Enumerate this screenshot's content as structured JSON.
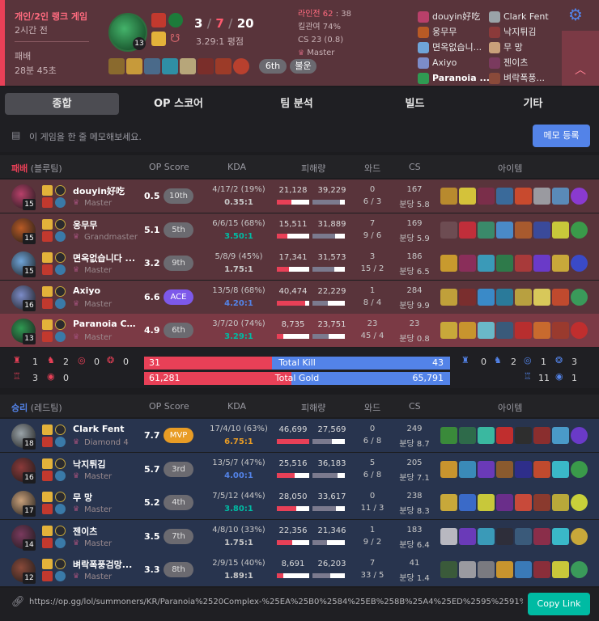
{
  "header": {
    "game_type": "개인/2인 랭크 게임",
    "time_ago": "2시간 전",
    "result": "패배",
    "duration": "28분 45초",
    "champion_level": "13",
    "kills": "3",
    "deaths": "7",
    "assists": "20",
    "kda_ratio": "3.29:1 평점",
    "laning_label": "라인전",
    "laning_a": "62",
    "laning_b": "38",
    "kp": "킬관여 74%",
    "cs": "CS 23 (0.8)",
    "tier": "Master",
    "badge_rank": "6th",
    "badge_tag": "불운",
    "players_left": [
      "douyin好吃",
      "웅무무",
      "면옥없습니...",
      "Axiyo",
      "Paranoia ..."
    ],
    "players_right": [
      "Clark Fent",
      "낙지튀김",
      "무 망",
      "젠이츠",
      "벼락폭풍..."
    ],
    "colors": {
      "lose_bg": "#59343b",
      "accent_red": "#e84057",
      "accent_blue": "#5383e8"
    }
  },
  "tabs": [
    "종합",
    "OP 스코어",
    "팀 분석",
    "빌드",
    "기타"
  ],
  "memo": {
    "placeholder": "이 게임을 한 줄 메모해보세요.",
    "button": "메모 등록"
  },
  "columns": {
    "op": "OP Score",
    "kda": "KDA",
    "dmg": "피해량",
    "ward": "와드",
    "cs": "CS",
    "items": "아이템"
  },
  "team_lose": {
    "label": "패배",
    "side": "(블루팀)",
    "players": [
      {
        "name": "douyin好吃",
        "tier": "Master",
        "level": "15",
        "score": "0.5",
        "rank": "10th",
        "kda_text": "4/17/2 (19%)",
        "kda_ratio": "0.35:1",
        "dealt": "21,128",
        "taken": "39,229",
        "dealt_pct": 0.45,
        "taken_pct": 0.85,
        "wards": "0",
        "wards2": "6 / 3",
        "cs": "167",
        "cs_min": "분당 5.8",
        "ratio_color": "gray",
        "champ_color": "#b8406a"
      },
      {
        "name": "웅무무",
        "tier": "Grandmaster",
        "level": "15",
        "score": "5.1",
        "rank": "5th",
        "kda_text": "6/6/15 (68%)",
        "kda_ratio": "3.50:1",
        "dealt": "15,511",
        "taken": "31,889",
        "dealt_pct": 0.33,
        "taken_pct": 0.69,
        "wards": "7",
        "wards2": "9 / 6",
        "cs": "169",
        "cs_min": "분당 5.9",
        "ratio_color": "teal",
        "champ_color": "#b85a25"
      },
      {
        "name": "면옥없습니다 ...",
        "tier": "Master",
        "level": "15",
        "score": "3.2",
        "rank": "9th",
        "kda_text": "5/8/9 (45%)",
        "kda_ratio": "1.75:1",
        "dealt": "17,341",
        "taken": "31,573",
        "dealt_pct": 0.37,
        "taken_pct": 0.68,
        "wards": "3",
        "wards2": "15 / 2",
        "cs": "186",
        "cs_min": "분당 6.5",
        "ratio_color": "gray",
        "champ_color": "#6fa4d8"
      },
      {
        "name": "Axiyo",
        "tier": "Master",
        "level": "16",
        "score": "6.6",
        "rank": "ACE",
        "kda_text": "13/5/8 (68%)",
        "kda_ratio": "4.20:1",
        "dealt": "40,474",
        "taken": "22,229",
        "dealt_pct": 0.87,
        "taken_pct": 0.48,
        "wards": "1",
        "wards2": "8 / 4",
        "cs": "284",
        "cs_min": "분당 9.9",
        "ratio_color": "blue",
        "champ_color": "#7c8cc8"
      },
      {
        "name": "Paranoia Co...",
        "tier": "Master",
        "level": "13",
        "score": "4.9",
        "rank": "6th",
        "kda_text": "3/7/20 (74%)",
        "kda_ratio": "3.29:1",
        "dealt": "8,735",
        "taken": "23,751",
        "dealt_pct": 0.19,
        "taken_pct": 0.51,
        "wards": "23",
        "wards2": "45 / 4",
        "cs": "23",
        "cs_min": "분당 0.8",
        "ratio_color": "teal",
        "champ_color": "#2f9a52"
      }
    ]
  },
  "summary": {
    "lose_objectives": [
      "1",
      "2",
      "0",
      "0",
      "3",
      "0"
    ],
    "win_objectives": [
      "0",
      "2",
      "1",
      "3",
      "11",
      "1"
    ],
    "total_kill_label": "Total Kill",
    "total_gold_label": "Total Gold",
    "kill_lose": "31",
    "kill_win": "43",
    "gold_lose": "61,281",
    "gold_win": "65,791",
    "kill_lose_frac": 0.419,
    "gold_lose_frac": 0.482
  },
  "team_win": {
    "label": "승리",
    "side": "(레드팀)",
    "players": [
      {
        "name": "Clark Fent",
        "tier": "Diamond 4",
        "level": "18",
        "score": "7.7",
        "rank": "MVP",
        "kda_text": "17/4/10 (63%)",
        "kda_ratio": "6.75:1",
        "dealt": "46,699",
        "taken": "27,569",
        "dealt_pct": 1.0,
        "taken_pct": 0.59,
        "wards": "0",
        "wards2": "6 / 8",
        "cs": "249",
        "cs_min": "분당 8.7",
        "ratio_color": "gold",
        "champ_color": "#9aa3a8"
      },
      {
        "name": "낙지튀김",
        "tier": "Master",
        "level": "16",
        "score": "5.7",
        "rank": "3rd",
        "kda_text": "13/5/7 (47%)",
        "kda_ratio": "4.00:1",
        "dealt": "25,516",
        "taken": "36,183",
        "dealt_pct": 0.55,
        "taken_pct": 0.78,
        "wards": "5",
        "wards2": "6 / 8",
        "cs": "205",
        "cs_min": "분당 7.1",
        "ratio_color": "blue",
        "champ_color": "#8b3a3a"
      },
      {
        "name": "무 망",
        "tier": "Master",
        "level": "17",
        "score": "5.2",
        "rank": "4th",
        "kda_text": "7/5/12 (44%)",
        "kda_ratio": "3.80:1",
        "dealt": "28,050",
        "taken": "33,617",
        "dealt_pct": 0.6,
        "taken_pct": 0.72,
        "wards": "0",
        "wards2": "11 / 3",
        "cs": "238",
        "cs_min": "분당 8.3",
        "ratio_color": "teal",
        "champ_color": "#c9a07a"
      },
      {
        "name": "젠이츠",
        "tier": "Master",
        "level": "14",
        "score": "3.5",
        "rank": "7th",
        "kda_text": "4/8/10 (33%)",
        "kda_ratio": "1.75:1",
        "dealt": "22,356",
        "taken": "21,346",
        "dealt_pct": 0.48,
        "taken_pct": 0.46,
        "wards": "1",
        "wards2": "9 / 2",
        "cs": "183",
        "cs_min": "분당 6.4",
        "ratio_color": "gray",
        "champ_color": "#7a3a5e"
      },
      {
        "name": "벼락폭풍검망...",
        "tier": "Master",
        "level": "12",
        "score": "3.3",
        "rank": "8th",
        "kda_text": "2/9/15 (40%)",
        "kda_ratio": "1.89:1",
        "dealt": "8,691",
        "taken": "26,203",
        "dealt_pct": 0.19,
        "taken_pct": 0.56,
        "wards": "7",
        "wards2": "33 / 5",
        "cs": "41",
        "cs_min": "분당 1.4",
        "ratio_color": "gray",
        "champ_color": "#8a4a3a"
      }
    ]
  },
  "url": {
    "text": "https://op.gg/lol/summoners/KR/Paranoia%2520Complex-%25EA%25B0%2584%25EB%258B%25A4%25ED%2595%2591%2...",
    "copy": "Copy Link"
  }
}
